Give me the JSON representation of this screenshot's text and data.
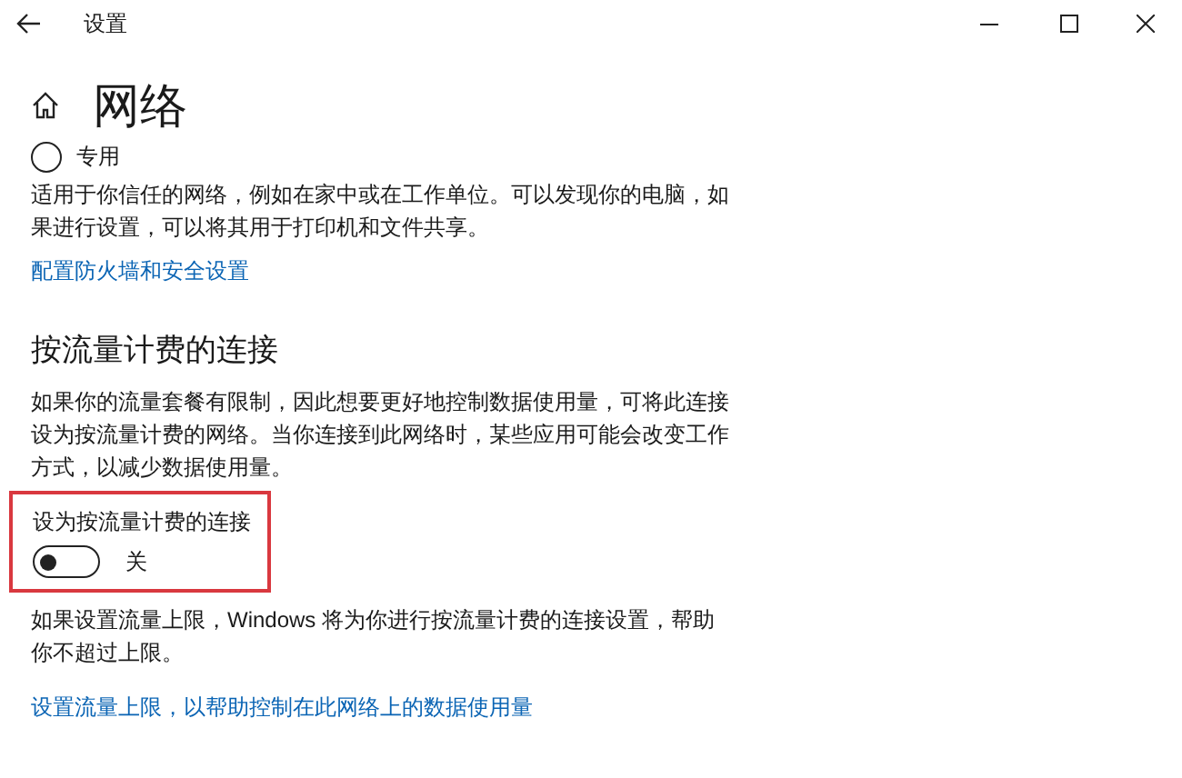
{
  "window": {
    "title": "设置"
  },
  "page_title": "网络",
  "network_profile": {
    "label": "专用",
    "selected": false
  },
  "profile_description": "适用于你信任的网络，例如在家中或在工作单位。可以发现你的电脑，如果进行设置，可以将其用于打印机和文件共享。",
  "firewall_link": "配置防火墙和安全设置",
  "metered": {
    "heading": "按流量计费的连接",
    "description": "如果你的流量套餐有限制，因此想要更好地控制数据使用量，可将此连接设为按流量计费的网络。当你连接到此网络时，某些应用可能会改变工作方式，以减少数据使用量。",
    "toggle": {
      "label": "设为按流量计费的连接",
      "on": false,
      "state_text": "关",
      "highlighted": true
    },
    "limit_note": "如果设置流量上限，Windows 将为你进行按流量计费的连接设置，帮助你不超过上限。",
    "limit_link": "设置流量上限，以帮助控制在此网络上的数据使用量"
  }
}
